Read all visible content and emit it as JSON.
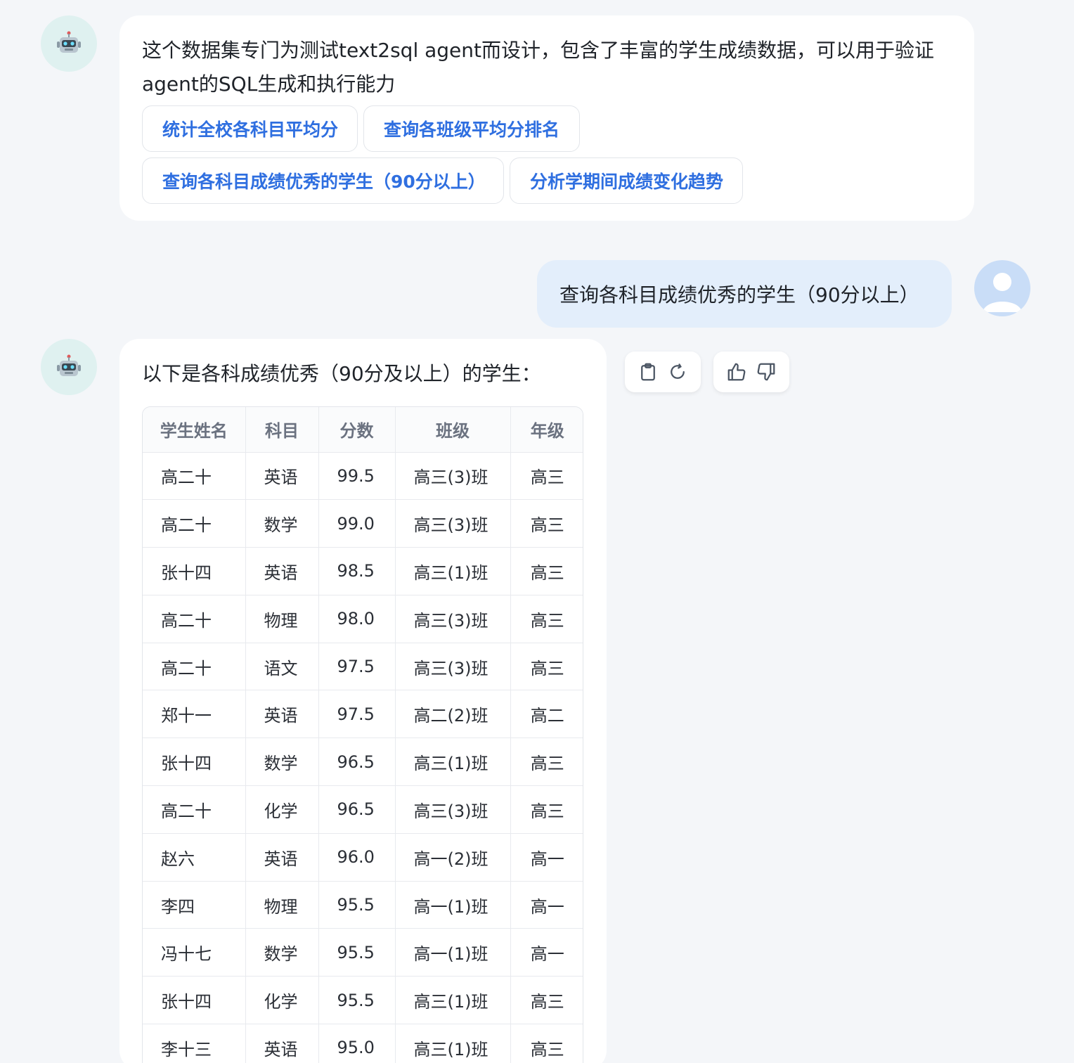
{
  "intro_message": {
    "text": "这个数据集专门为测试text2sql agent而设计，包含了丰富的学生成绩数据，可以用于验证agent的SQL生成和执行能力",
    "suggestions": [
      "统计全校各科目平均分",
      "查询各班级平均分排名",
      "查询各科目成绩优秀的学生（90分以上）",
      "分析学期间成绩变化趋势"
    ]
  },
  "user_message": {
    "text": "查询各科目成绩优秀的学生（90分以上）"
  },
  "reply_message": {
    "intro": "以下是各科成绩优秀（90分及以上）的学生：",
    "columns": [
      "学生姓名",
      "科目",
      "分数",
      "班级",
      "年级"
    ],
    "rows": [
      [
        "高二十",
        "英语",
        "99.5",
        "高三(3)班",
        "高三"
      ],
      [
        "高二十",
        "数学",
        "99.0",
        "高三(3)班",
        "高三"
      ],
      [
        "张十四",
        "英语",
        "98.5",
        "高三(1)班",
        "高三"
      ],
      [
        "高二十",
        "物理",
        "98.0",
        "高三(3)班",
        "高三"
      ],
      [
        "高二十",
        "语文",
        "97.5",
        "高三(3)班",
        "高三"
      ],
      [
        "郑十一",
        "英语",
        "97.5",
        "高二(2)班",
        "高二"
      ],
      [
        "张十四",
        "数学",
        "96.5",
        "高三(1)班",
        "高三"
      ],
      [
        "高二十",
        "化学",
        "96.5",
        "高三(3)班",
        "高三"
      ],
      [
        "赵六",
        "英语",
        "96.0",
        "高一(2)班",
        "高一"
      ],
      [
        "李四",
        "物理",
        "95.5",
        "高一(1)班",
        "高一"
      ],
      [
        "冯十七",
        "数学",
        "95.5",
        "高一(1)班",
        "高一"
      ],
      [
        "张十四",
        "化学",
        "95.5",
        "高三(1)班",
        "高三"
      ],
      [
        "李十三",
        "英语",
        "95.0",
        "高三(1)班",
        "高三"
      ]
    ]
  },
  "actions": {
    "copy_icon": "clipboard-icon",
    "regenerate_icon": "refresh-icon",
    "like_icon": "thumbs-up-icon",
    "dislike_icon": "thumbs-down-icon"
  },
  "colors": {
    "background": "#f4f6f9",
    "suggestion_text": "#2f6fe0",
    "user_bubble": "#e3eefb",
    "bot_avatar_bg": "#dff1f0"
  }
}
